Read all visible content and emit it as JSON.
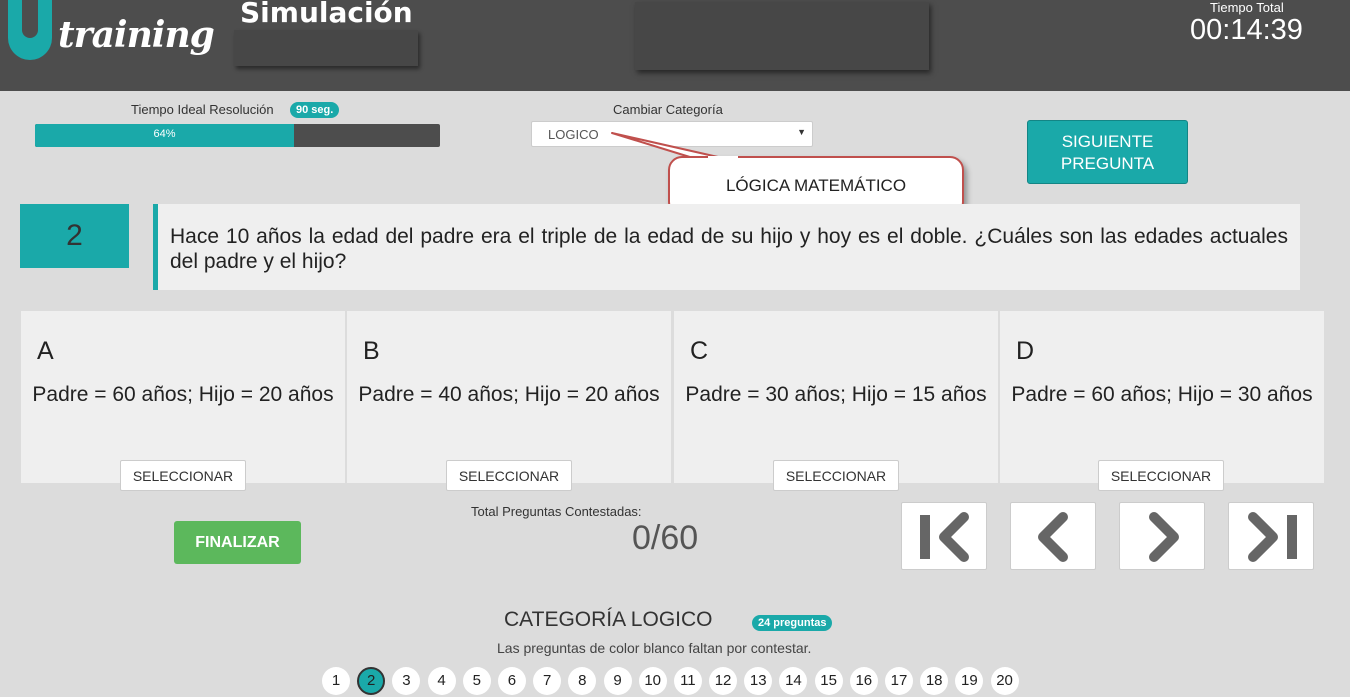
{
  "header": {
    "logo_text": "training",
    "title": "Simulación",
    "time_label": "Tiempo Total",
    "time_value": "00:14:39"
  },
  "ideal_time": {
    "label": "Tiempo Ideal Resolución",
    "badge": "90 seg.",
    "progress_percent": 64,
    "progress_text": "64%"
  },
  "category": {
    "label": "Cambiar Categoría",
    "selected": "LOGICO"
  },
  "next_button": {
    "line1": "SIGUIENTE",
    "line2": "PREGUNTA"
  },
  "callout": "LÓGICA MATEMÁTICO",
  "question": {
    "number": "2",
    "text": "Hace 10 años la edad del padre era el triple de la edad de su hijo y hoy es el doble. ¿Cuáles son las edades actuales del padre y el hijo?"
  },
  "options": [
    {
      "letter": "A",
      "text": "Padre = 60 años; Hijo = 20 años",
      "button": "SELECCIONAR"
    },
    {
      "letter": "B",
      "text": "Padre = 40 años; Hijo = 20 años",
      "button": "SELECCIONAR"
    },
    {
      "letter": "C",
      "text": "Padre = 30 años; Hijo = 15 años",
      "button": "SELECCIONAR"
    },
    {
      "letter": "D",
      "text": "Padre = 60 años; Hijo = 30 años",
      "button": "SELECCIONAR"
    }
  ],
  "finish_button": "FINALIZAR",
  "answered": {
    "label": "Total Preguntas Contestadas:",
    "value": "0/60"
  },
  "navigation": [
    "first-icon",
    "previous-icon",
    "next-icon",
    "last-icon"
  ],
  "category_section": {
    "title": "CATEGORÍA LOGICO",
    "badge": "24 preguntas",
    "subtitle": "Las preguntas de color blanco faltan por contestar."
  },
  "pages": [
    "1",
    "2",
    "3",
    "4",
    "5",
    "6",
    "7",
    "8",
    "9",
    "10",
    "11",
    "12",
    "13",
    "14",
    "15",
    "16",
    "17",
    "18",
    "19",
    "20"
  ],
  "active_page": "2",
  "colors": {
    "accent": "#1aa9a9",
    "header": "#4d4d4d",
    "success": "#5cb85c",
    "callout_border": "#c0504d"
  }
}
